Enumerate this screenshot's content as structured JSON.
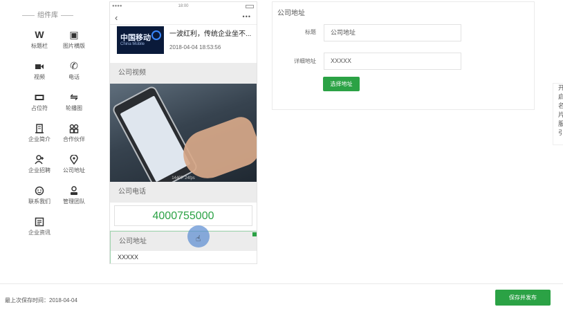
{
  "library": {
    "title": "组件库",
    "items": [
      {
        "icon": "title-bar-icon",
        "glyph": "W",
        "label": "标题栏"
      },
      {
        "icon": "image-nav-icon",
        "glyph": "▣",
        "label": "图片横版"
      },
      {
        "icon": "video-icon",
        "glyph": "■",
        "label": "视频"
      },
      {
        "icon": "phone-icon",
        "glyph": "✆",
        "label": "电话"
      },
      {
        "icon": "placeholder-icon",
        "glyph": "▭",
        "label": "占位符"
      },
      {
        "icon": "carousel-icon",
        "glyph": "⇋",
        "label": "轮播图"
      },
      {
        "icon": "company-intro-icon",
        "glyph": "⊞",
        "label": "企业简介"
      },
      {
        "icon": "partners-icon",
        "glyph": "⁘",
        "label": "合作伙伴"
      },
      {
        "icon": "recruit-icon",
        "glyph": "⚇",
        "label": "企业招聘"
      },
      {
        "icon": "address-icon",
        "glyph": "◉",
        "label": "公司地址"
      },
      {
        "icon": "contact-icon",
        "glyph": "☺",
        "label": "联系我们"
      },
      {
        "icon": "team-icon",
        "glyph": "⚉",
        "label": "管理团队"
      },
      {
        "icon": "news-icon",
        "glyph": "☰",
        "label": "企业资讯"
      }
    ]
  },
  "phone": {
    "status_time": "18:00",
    "status_signal": "●●●●",
    "news": {
      "logo_cn": "中国移动",
      "logo_en": "China Mobile",
      "headline": "一波红利，传统企业坐不...",
      "date": "2018-04-04 18:53:56"
    },
    "video_title": "公司视频",
    "video_caption": "1440P 24fps",
    "phone_title": "公司电话",
    "phone_number": "4000755000",
    "address_title": "公司地址",
    "address_value": "XXXXX"
  },
  "panel": {
    "title": "公司地址",
    "title_label": "标题",
    "title_value": "公司地址",
    "detail_label": "详细地址",
    "detail_value": "XXXXX",
    "select_button": "选择地址"
  },
  "edge_chars": [
    "开",
    "启",
    "名",
    "片",
    "服",
    "引"
  ],
  "footer": {
    "last_saved": "最上次保存时间：2018-04-04",
    "save_publish": "保存并发布"
  },
  "colors": {
    "accent": "#2ba245",
    "selection_border": "#9ed3ad"
  }
}
